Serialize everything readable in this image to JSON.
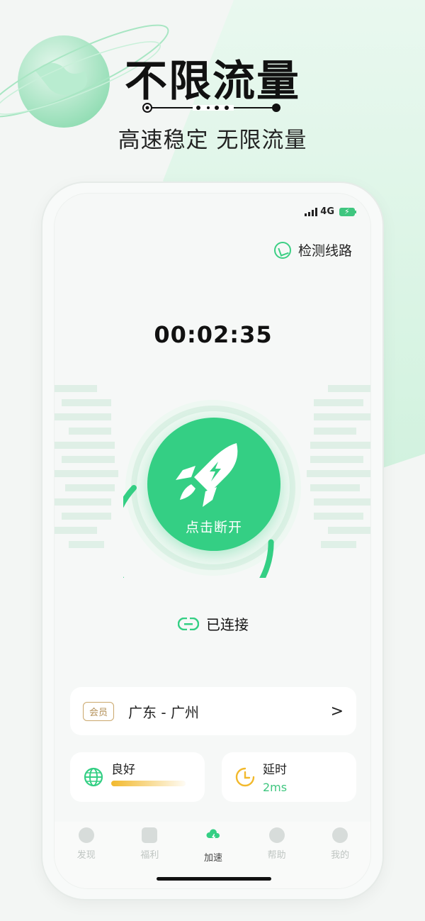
{
  "promo": {
    "title": "不限流量",
    "subtitle": "高速稳定 无限流量"
  },
  "statusbar": {
    "network": "4G",
    "battery": "charging"
  },
  "header": {
    "detect_label": "检测线路"
  },
  "timer": "00:02:35",
  "connect_button": {
    "label": "点击断开",
    "progress": 0.62
  },
  "connection_status": "已连接",
  "server": {
    "badge": "会员",
    "name": "广东 - 广州",
    "chevron": ">"
  },
  "stats": {
    "quality_label": "良好",
    "quality_level": 0.75,
    "latency_label": "延时",
    "latency_value": "2ms"
  },
  "tabs": [
    {
      "label": "发现",
      "icon": "compass-icon",
      "active": false
    },
    {
      "label": "福利",
      "icon": "gift-icon",
      "active": false
    },
    {
      "label": "加速",
      "icon": "cloud-bolt-icon",
      "active": true
    },
    {
      "label": "帮助",
      "icon": "help-icon",
      "active": false
    },
    {
      "label": "我的",
      "icon": "profile-icon",
      "active": false
    }
  ],
  "colors": {
    "accent": "#34cf84",
    "badge": "#b4915a",
    "quality_bar": "#f2b92d"
  }
}
